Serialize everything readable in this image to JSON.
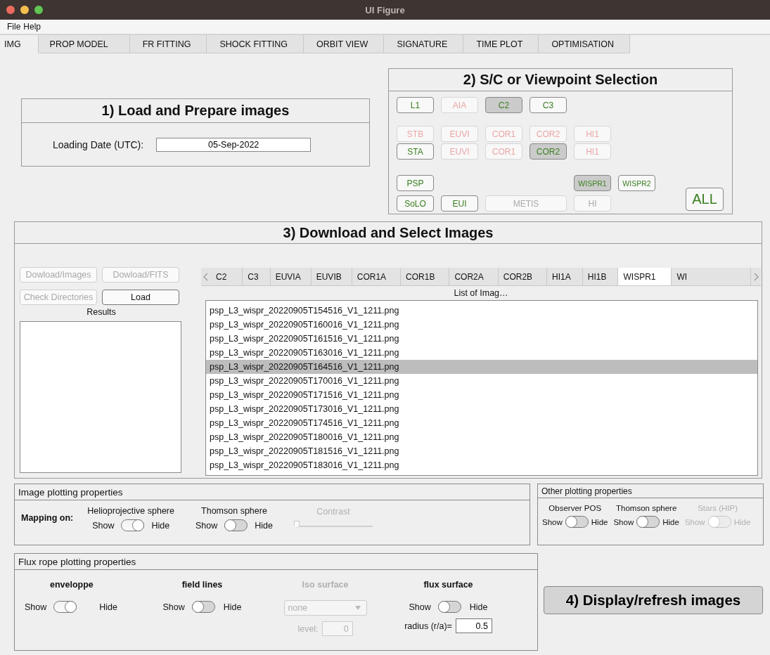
{
  "window": {
    "title": "UI Figure"
  },
  "menu": [
    "File",
    "Help"
  ],
  "tabs": [
    {
      "label": "IMG",
      "selected": true
    },
    {
      "label": "PROP MODEL",
      "selected": false
    },
    {
      "label": "FR FITTING",
      "selected": false
    },
    {
      "label": "SHOCK FITTING",
      "selected": false
    },
    {
      "label": "ORBIT VIEW",
      "selected": false
    },
    {
      "label": "SIGNATURE",
      "selected": false
    },
    {
      "label": "TIME PLOT",
      "selected": false
    },
    {
      "label": "OPTIMISATION",
      "selected": false
    }
  ],
  "load_panel": {
    "title": "1) Load and Prepare images",
    "date_label": "Loading Date (UTC):",
    "date_value": "05-Sep-2022"
  },
  "viewpoint_panel": {
    "title": "2) S/C or Viewpoint Selection",
    "groups": [
      [
        {
          "label": "L1",
          "selected": false,
          "available": true,
          "disabled": false
        },
        {
          "label": "AIA",
          "selected": false,
          "available": false,
          "disabled": false
        },
        {
          "label": "C2",
          "selected": true,
          "available": true,
          "disabled": false
        },
        {
          "label": "C3",
          "selected": false,
          "available": true,
          "disabled": false
        }
      ],
      [
        {
          "label": "STB",
          "selected": false,
          "available": false,
          "disabled": false
        },
        {
          "label": "EUVI",
          "selected": false,
          "available": false,
          "disabled": false
        },
        {
          "label": "COR1",
          "selected": false,
          "available": false,
          "disabled": false
        },
        {
          "label": "COR2",
          "selected": false,
          "available": false,
          "disabled": false
        },
        {
          "label": "HI1",
          "selected": false,
          "available": false,
          "disabled": false
        }
      ],
      [
        {
          "label": "STA",
          "selected": false,
          "available": true,
          "disabled": false
        },
        {
          "label": "EUVI",
          "selected": false,
          "available": false,
          "disabled": false
        },
        {
          "label": "COR1",
          "selected": false,
          "available": false,
          "disabled": false
        },
        {
          "label": "COR2",
          "selected": true,
          "available": true,
          "disabled": false
        },
        {
          "label": "HI1",
          "selected": false,
          "available": false,
          "disabled": false
        }
      ],
      [
        {
          "label": "PSP",
          "selected": false,
          "available": true,
          "disabled": false
        },
        {
          "label": "WISPR1",
          "selected": true,
          "available": true,
          "disabled": false
        },
        {
          "label": "WISPR2",
          "selected": false,
          "available": true,
          "disabled": false
        }
      ],
      [
        {
          "label": "SoLO",
          "selected": false,
          "available": true,
          "disabled": false
        },
        {
          "label": "EUI",
          "selected": false,
          "available": true,
          "disabled": false
        },
        {
          "label": "METIS",
          "selected": false,
          "disabled": true
        },
        {
          "label": "HI",
          "selected": false,
          "disabled": true
        }
      ]
    ],
    "all_button": "ALL"
  },
  "download_panel": {
    "title": "3) Download and Select Images",
    "buttons": [
      {
        "label": "Dowload/Images",
        "disabled": true
      },
      {
        "label": "Dowload/FITS",
        "disabled": true
      },
      {
        "label": "Check Directories",
        "disabled": true
      },
      {
        "label": "Load",
        "disabled": false
      }
    ],
    "results_label": "Results",
    "instrument_tabs": [
      {
        "label": "C2",
        "selected": false
      },
      {
        "label": "C3",
        "selected": false
      },
      {
        "label": "EUVIA",
        "selected": false
      },
      {
        "label": "EUVIB",
        "selected": false
      },
      {
        "label": "COR1A",
        "selected": false
      },
      {
        "label": "COR1B",
        "selected": false
      },
      {
        "label": "COR2A",
        "selected": false
      },
      {
        "label": "COR2B",
        "selected": false
      },
      {
        "label": "HI1A",
        "selected": false
      },
      {
        "label": "HI1B",
        "selected": false
      },
      {
        "label": "WISPR1",
        "selected": true
      },
      {
        "label": "WI",
        "selected": false
      }
    ],
    "list_label": "List of Imag…",
    "files": [
      {
        "name": "psp_L3_wispr_20220905T154516_V1_1211.png",
        "selected": false
      },
      {
        "name": "psp_L3_wispr_20220905T160016_V1_1211.png",
        "selected": false
      },
      {
        "name": "psp_L3_wispr_20220905T161516_V1_1211.png",
        "selected": false
      },
      {
        "name": "psp_L3_wispr_20220905T163016_V1_1211.png",
        "selected": false
      },
      {
        "name": "psp_L3_wispr_20220905T164516_V1_1211.png",
        "selected": true
      },
      {
        "name": "psp_L3_wispr_20220905T170016_V1_1211.png",
        "selected": false
      },
      {
        "name": "psp_L3_wispr_20220905T171516_V1_1211.png",
        "selected": false
      },
      {
        "name": "psp_L3_wispr_20220905T173016_V1_1211.png",
        "selected": false
      },
      {
        "name": "psp_L3_wispr_20220905T174516_V1_1211.png",
        "selected": false
      },
      {
        "name": "psp_L3_wispr_20220905T180016_V1_1211.png",
        "selected": false
      },
      {
        "name": "psp_L3_wispr_20220905T181516_V1_1211.png",
        "selected": false
      },
      {
        "name": "psp_L3_wispr_20220905T183016_V1_1211.png",
        "selected": false
      }
    ]
  },
  "image_plotting": {
    "title": "Image plotting properties",
    "mapping_label": "Mapping on:",
    "switches": [
      {
        "label": "Helioprojective sphere",
        "left": "Show",
        "right": "Hide",
        "hide": true,
        "disabled": false
      },
      {
        "label": "Thomson sphere",
        "left": "Show",
        "right": "Hide",
        "hide": false,
        "disabled": false
      }
    ],
    "contrast": {
      "label": "Contrast",
      "level": 0,
      "disabled": true
    }
  },
  "other_plotting": {
    "title": "Other plotting properties",
    "switches": [
      {
        "label": "Observer POS",
        "left": "Show",
        "right": "Hide",
        "hide": false,
        "disabled": false
      },
      {
        "label": "Thomson sphere",
        "left": "Show",
        "right": "Hide",
        "hide": false,
        "disabled": false
      },
      {
        "label": "Stars (HIP)",
        "left": "Show",
        "right": "Hide",
        "hide": false,
        "disabled": true
      }
    ]
  },
  "flux_rope": {
    "title": "Flux rope plotting properties",
    "columns": [
      {
        "kind": "switch",
        "label": "enveloppe",
        "left": "Show",
        "right": "Hide",
        "hide": true,
        "disabled": false
      },
      {
        "kind": "switch",
        "label": "field lines",
        "left": "Show",
        "right": "Hide",
        "hide": false,
        "disabled": false
      },
      {
        "kind": "dropdown",
        "label": "Iso surface",
        "value": "none",
        "level_label": "level:",
        "level_value": "0",
        "disabled": true
      },
      {
        "kind": "switch",
        "label": "flux surface",
        "left": "Show",
        "right": "Hide",
        "hide": false,
        "disabled": false,
        "field_label": "radius (r/a)=",
        "field_value": "0.5"
      }
    ]
  },
  "display_button": "4) Display/refresh images"
}
